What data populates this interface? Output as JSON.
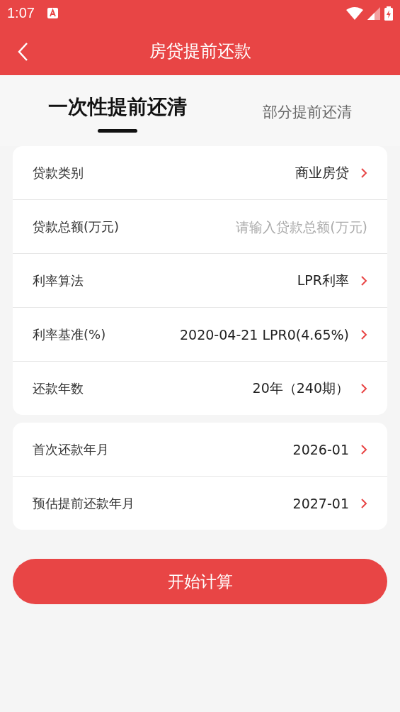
{
  "status_bar": {
    "time": "1:07"
  },
  "header": {
    "title": "房贷提前还款"
  },
  "tabs": [
    {
      "label": "一次性提前还清",
      "selected": true
    },
    {
      "label": "部分提前还清",
      "selected": false
    }
  ],
  "groups": [
    {
      "rows": [
        {
          "kind": "select",
          "label": "贷款类别",
          "value": "商业房贷"
        },
        {
          "kind": "input",
          "label": "贷款总额(万元)",
          "placeholder": "请输入贷款总额(万元)"
        },
        {
          "kind": "select",
          "label": "利率算法",
          "value": "LPR利率"
        },
        {
          "kind": "select",
          "label": "利率基准(%)",
          "value": "2020-04-21 LPR0(4.65%)"
        },
        {
          "kind": "select",
          "label": "还款年数",
          "value": "20年（240期）"
        }
      ]
    },
    {
      "rows": [
        {
          "kind": "select",
          "label": "首次还款年月",
          "value": "2026-01"
        },
        {
          "kind": "select",
          "label": "预估提前还款年月",
          "value": "2027-01"
        }
      ]
    }
  ],
  "button": {
    "label": "开始计算"
  }
}
